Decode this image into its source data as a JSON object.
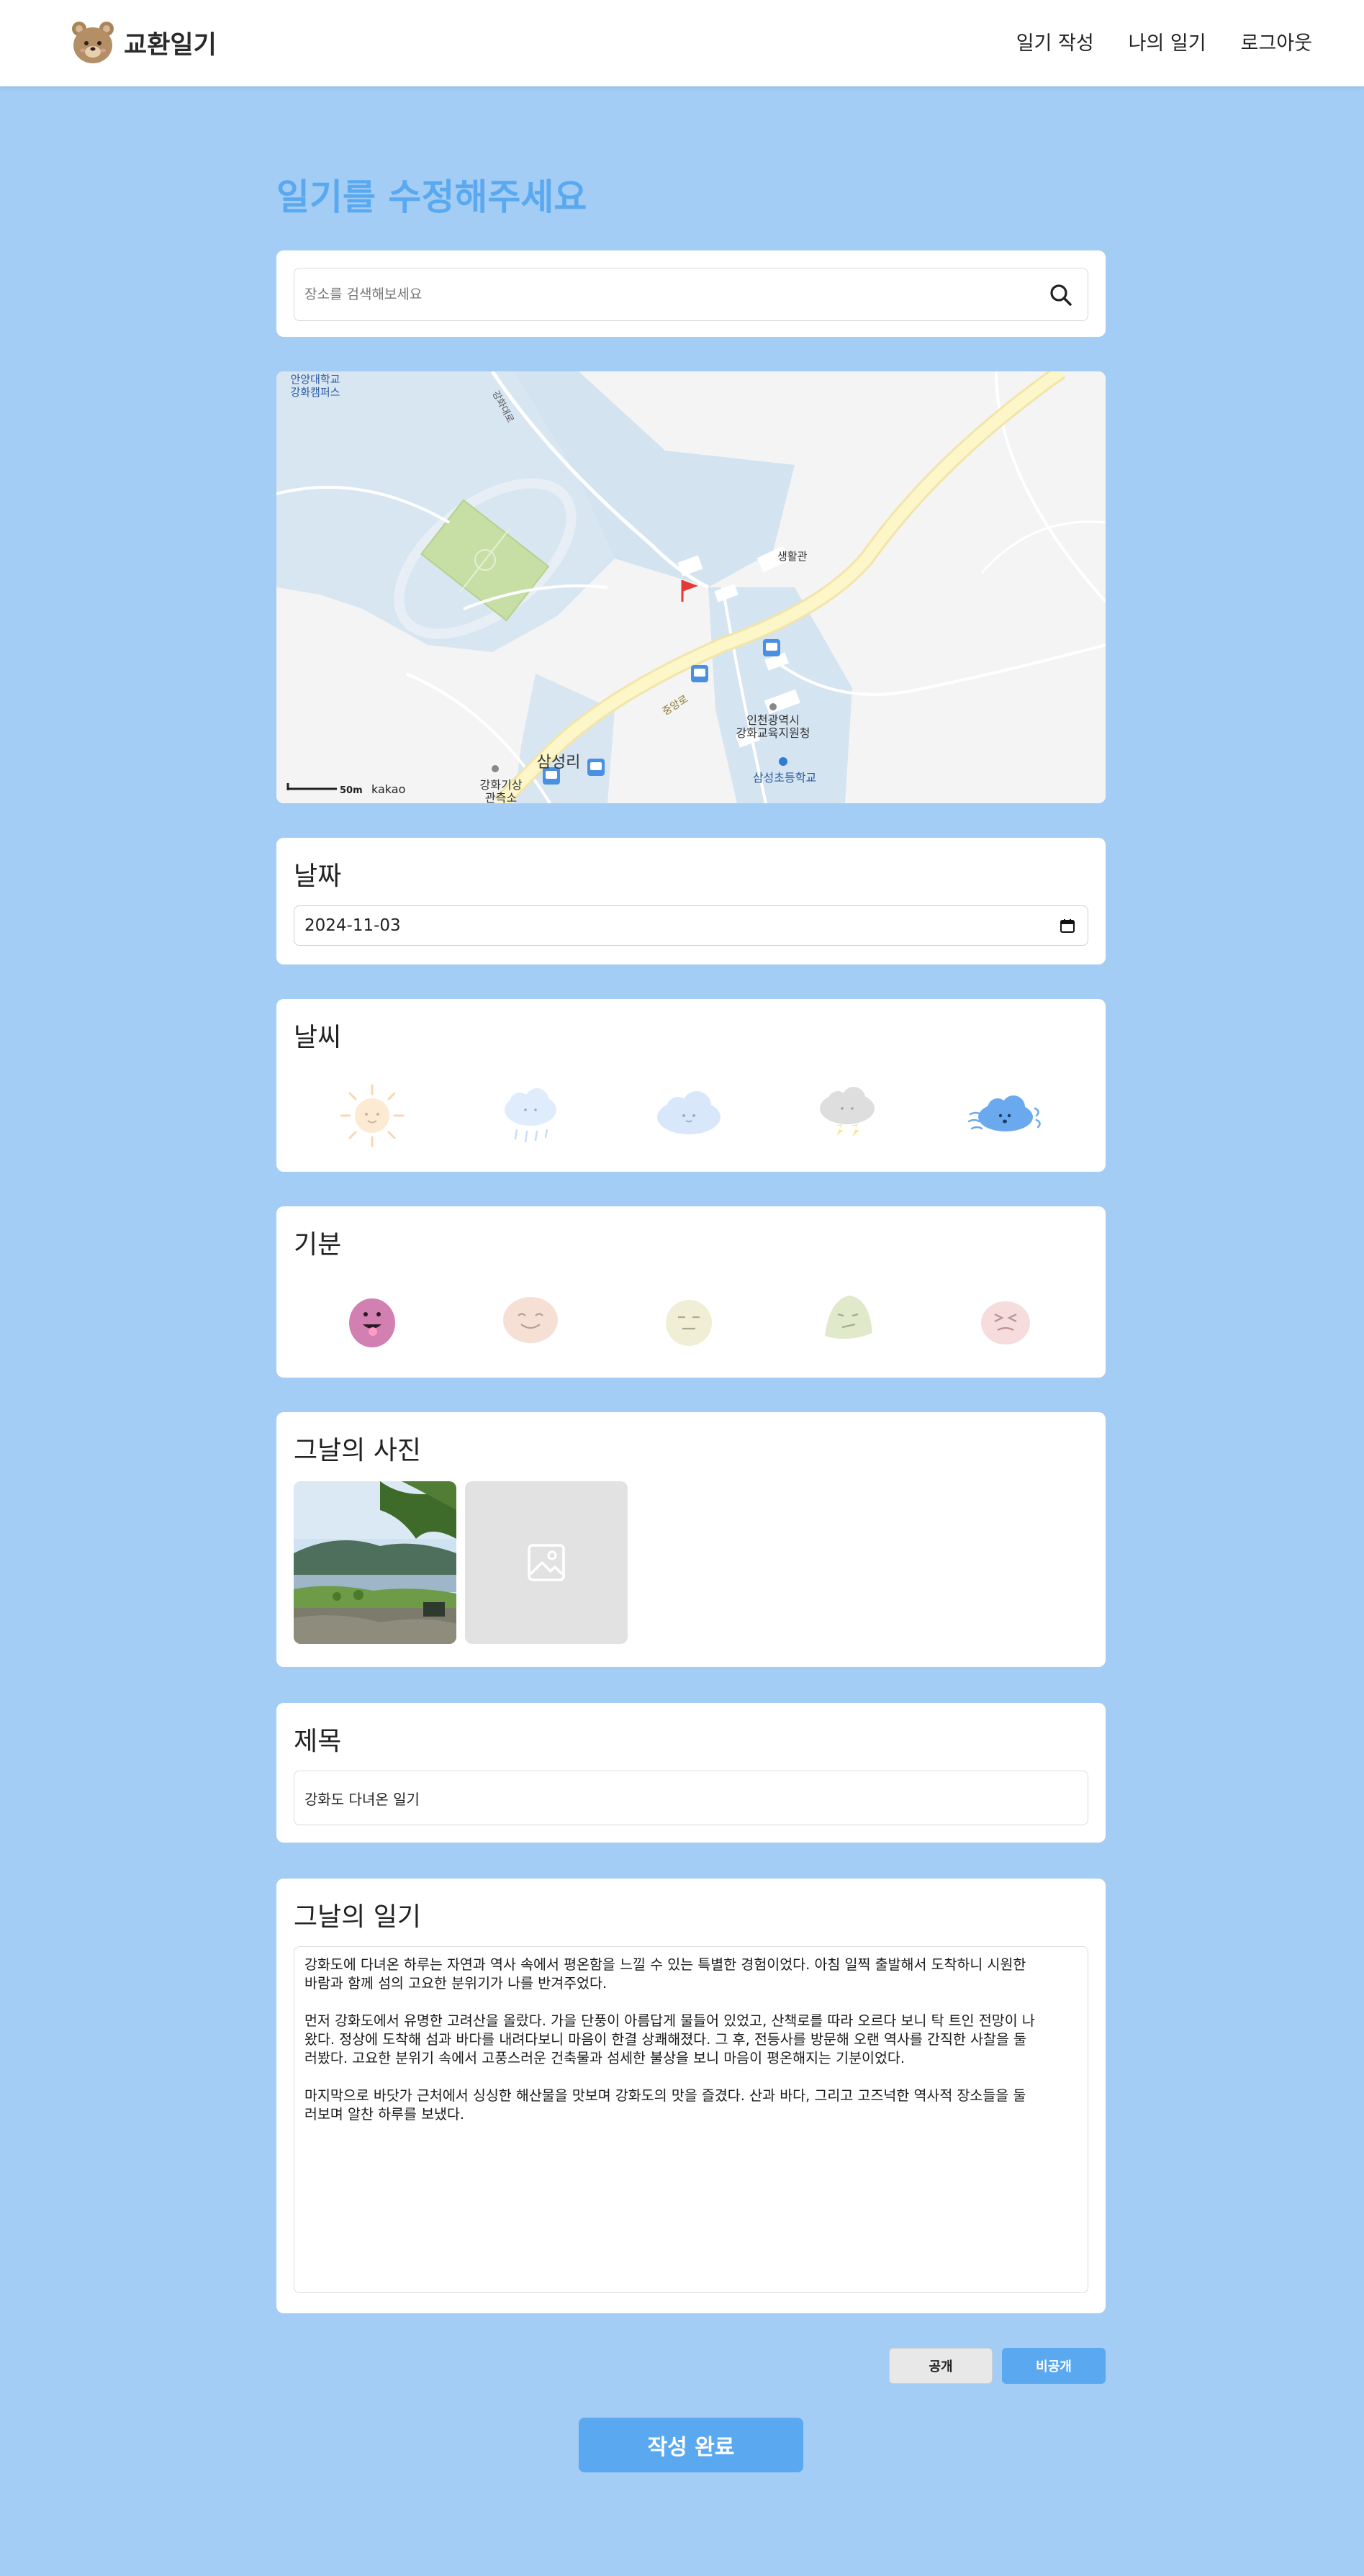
{
  "header": {
    "brand": "교환일기",
    "nav": [
      "일기 작성",
      "나의 일기",
      "로그아웃"
    ]
  },
  "page_title": "일기를 수정해주세요",
  "search": {
    "placeholder": "장소를 검색해보세요"
  },
  "map": {
    "labels": {
      "univ": "안양대학교",
      "univ2": "강화캠퍼스",
      "hall": "생활관",
      "office1": "인천광역시",
      "office2": "강화교육지원청",
      "school": "삼성초등학교",
      "town": "삼성리",
      "weather1": "강화기상",
      "weather2": "관측소",
      "road1": "중앙로",
      "road2": "강화대로",
      "scale": "50m",
      "provider": "kakao"
    }
  },
  "date_section": {
    "label": "날짜",
    "value": "2024-11-03"
  },
  "weather_section": {
    "label": "날씨",
    "options": [
      "sun-icon",
      "rain-cloud-icon",
      "cloud-icon",
      "thunder-cloud-icon",
      "wind-cloud-icon"
    ],
    "selected_index": 4
  },
  "mood_section": {
    "label": "기분",
    "options": [
      "excited-face-icon",
      "happy-face-icon",
      "neutral-face-icon",
      "meh-face-icon",
      "angry-face-icon"
    ],
    "selected_index": 0
  },
  "photo_section": {
    "label": "그날의 사진"
  },
  "title_section": {
    "label": "제목",
    "value": "강화도 다녀온 일기"
  },
  "diary_section": {
    "label": "그날의 일기",
    "value": "강화도에 다녀온 하루는 자연과 역사 속에서 평온함을 느낄 수 있는 특별한 경험이었다. 아침 일찍 출발해서 도착하니 시원한\n바람과 함께 섬의 고요한 분위기가 나를 반겨주었다.\n\n먼저 강화도에서 유명한 고려산을 올랐다. 가을 단풍이 아름답게 물들어 있었고, 산책로를 따라 오르다 보니 탁 트인 전망이 나\n왔다. 정상에 도착해 섬과 바다를 내려다보니 마음이 한결 상쾌해졌다. 그 후, 전등사를 방문해 오랜 역사를 간직한 사찰을 둘\n러봤다. 고요한 분위기 속에서 고풍스러운 건축물과 섬세한 불상을 보니 마음이 평온해지는 기분이었다.\n\n마지막으로 바닷가 근처에서 싱싱한 해산물을 맛보며 강화도의 맛을 즐겼다. 산과 바다, 그리고 고즈넉한 역사적 장소들을 둘\n러보며 알찬 하루를 보냈다."
  },
  "visibility": {
    "public": "공개",
    "private": "비공개",
    "selected": "비공개"
  },
  "submit_label": "작성 완료",
  "colors": {
    "accent": "#5aa9f0",
    "background": "#a3cdf5"
  }
}
